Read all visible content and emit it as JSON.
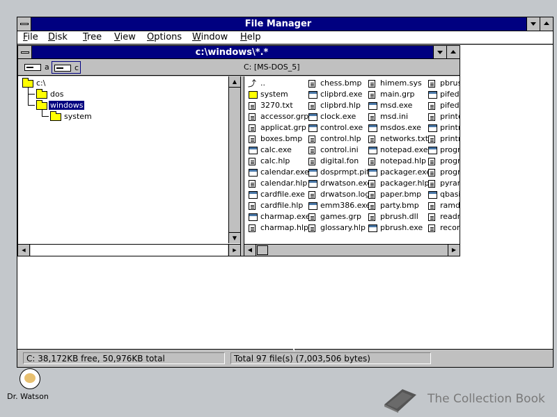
{
  "window": {
    "title": "File Manager"
  },
  "menu": [
    "File",
    "Disk",
    "Tree",
    "View",
    "Options",
    "Window",
    "Help"
  ],
  "child": {
    "title": "c:\\windows\\*.*",
    "drives": [
      {
        "label": "a"
      },
      {
        "label": "c"
      }
    ],
    "volume": "C: [MS-DOS_5]",
    "tree": [
      {
        "label": "c:\\",
        "depth": 0
      },
      {
        "label": "dos",
        "depth": 1
      },
      {
        "label": "windows",
        "depth": 1,
        "selected": true
      },
      {
        "label": "system",
        "depth": 2
      }
    ],
    "files": [
      [
        {
          "name": "..",
          "icon": "up"
        },
        {
          "name": "system",
          "icon": "fold"
        },
        {
          "name": "3270.txt",
          "icon": "doc"
        },
        {
          "name": "accessor.grp",
          "icon": "doc"
        },
        {
          "name": "applicat.grp",
          "icon": "doc"
        },
        {
          "name": "boxes.bmp",
          "icon": "doc"
        },
        {
          "name": "calc.exe",
          "icon": "exe"
        },
        {
          "name": "calc.hlp",
          "icon": "doc"
        },
        {
          "name": "calendar.exe",
          "icon": "exe"
        },
        {
          "name": "calendar.hlp",
          "icon": "doc"
        },
        {
          "name": "cardfile.exe",
          "icon": "exe"
        },
        {
          "name": "cardfile.hlp",
          "icon": "doc"
        },
        {
          "name": "charmap.exe",
          "icon": "exe"
        },
        {
          "name": "charmap.hlp",
          "icon": "doc"
        }
      ],
      [
        {
          "name": "chess.bmp",
          "icon": "doc"
        },
        {
          "name": "clipbrd.exe",
          "icon": "exe"
        },
        {
          "name": "clipbrd.hlp",
          "icon": "doc"
        },
        {
          "name": "clock.exe",
          "icon": "exe"
        },
        {
          "name": "control.exe",
          "icon": "exe"
        },
        {
          "name": "control.hlp",
          "icon": "doc"
        },
        {
          "name": "control.ini",
          "icon": "doc"
        },
        {
          "name": "digital.fon",
          "icon": "doc"
        },
        {
          "name": "dosprmpt.pif",
          "icon": "exe"
        },
        {
          "name": "drwatson.exe",
          "icon": "exe"
        },
        {
          "name": "drwatson.log",
          "icon": "doc"
        },
        {
          "name": "emm386.exe",
          "icon": "exe"
        },
        {
          "name": "games.grp",
          "icon": "doc"
        },
        {
          "name": "glossary.hlp",
          "icon": "doc"
        }
      ],
      [
        {
          "name": "himem.sys",
          "icon": "doc"
        },
        {
          "name": "main.grp",
          "icon": "doc"
        },
        {
          "name": "msd.exe",
          "icon": "exe"
        },
        {
          "name": "msd.ini",
          "icon": "doc"
        },
        {
          "name": "msdos.exe",
          "icon": "exe"
        },
        {
          "name": "networks.txt",
          "icon": "doc"
        },
        {
          "name": "notepad.exe",
          "icon": "exe"
        },
        {
          "name": "notepad.hlp",
          "icon": "doc"
        },
        {
          "name": "packager.exe",
          "icon": "exe"
        },
        {
          "name": "packager.hlp",
          "icon": "doc"
        },
        {
          "name": "paper.bmp",
          "icon": "doc"
        },
        {
          "name": "party.bmp",
          "icon": "doc"
        },
        {
          "name": "pbrush.dll",
          "icon": "doc"
        },
        {
          "name": "pbrush.exe",
          "icon": "exe"
        }
      ],
      [
        {
          "name": "pbrush",
          "icon": "doc"
        },
        {
          "name": "pifedit",
          "icon": "exe"
        },
        {
          "name": "pifedit",
          "icon": "doc"
        },
        {
          "name": "printer",
          "icon": "doc"
        },
        {
          "name": "printm",
          "icon": "exe"
        },
        {
          "name": "printm",
          "icon": "doc"
        },
        {
          "name": "progm",
          "icon": "exe"
        },
        {
          "name": "progm",
          "icon": "doc"
        },
        {
          "name": "progm",
          "icon": "doc"
        },
        {
          "name": "pyram",
          "icon": "doc"
        },
        {
          "name": "qbasic",
          "icon": "exe"
        },
        {
          "name": "ramdr",
          "icon": "doc"
        },
        {
          "name": "readm",
          "icon": "doc"
        },
        {
          "name": "record",
          "icon": "doc"
        }
      ]
    ]
  },
  "status": {
    "free": "C: 38,172KB free,  50,976KB total",
    "total": "Total 97 file(s) (7,003,506 bytes)"
  },
  "desktop": {
    "icon_label": "Dr. Watson"
  },
  "watermark": {
    "text": "The Collection Book"
  },
  "colors": {
    "titlebar": "#000080",
    "desktop": "#c3c7cb",
    "selection": "#000080"
  }
}
